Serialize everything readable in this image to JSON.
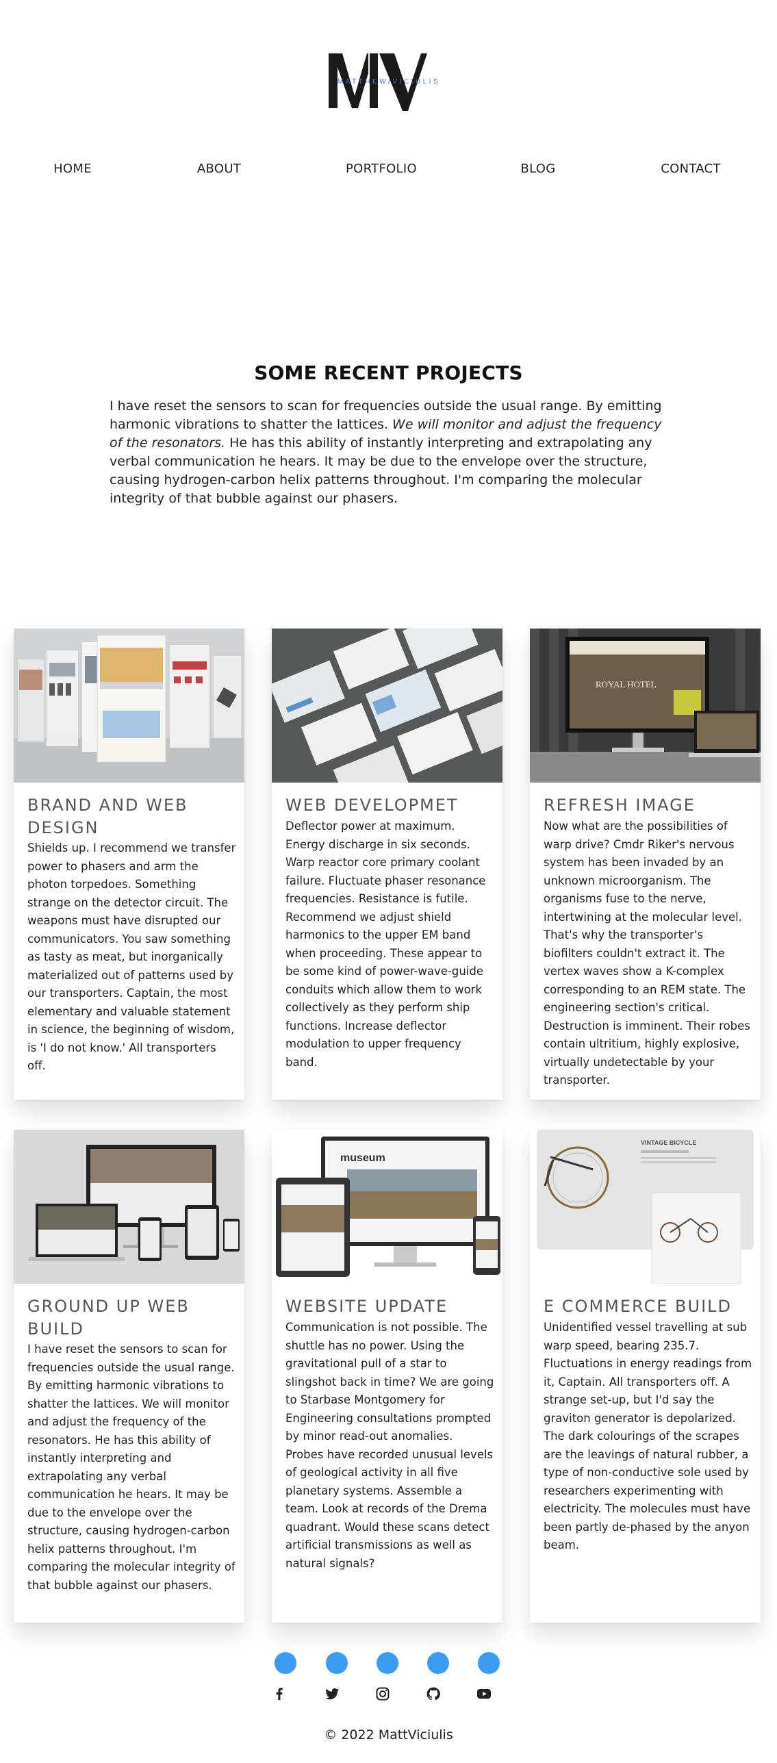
{
  "logo": {
    "letters": "MV",
    "subtitle": "MATTHEW/VICIULIS"
  },
  "nav": {
    "items": [
      {
        "label": "HOME"
      },
      {
        "label": "ABOUT"
      },
      {
        "label": "PORTFOLIO"
      },
      {
        "label": "BLOG"
      },
      {
        "label": "CONTACT"
      }
    ]
  },
  "section": {
    "title": "SOME RECENT PROJECTS",
    "intro_part1": "I have reset the sensors to scan for frequencies outside the usual range. By emitting harmonic vibrations to shatter the lattices. ",
    "intro_italic": "We will monitor and adjust the frequency of the resonators.",
    "intro_part2": " He has this ability of instantly interpreting and extrapolating any verbal communication he hears. It may be due to the envelope over the structure, causing hydrogen-carbon helix patterns throughout. I'm comparing the molecular integrity of that bubble against our phasers."
  },
  "projects": [
    {
      "title": "BRAND AND WEB DESIGN",
      "text": "Shields up. I recommend we transfer power to phasers and arm the photon torpedoes. Something strange on the detector circuit. The weapons must have disrupted our communicators. You saw something as tasty as meat, but inorganically materialized out of patterns used by our transporters. Captain, the most elementary and valuable statement in science, the beginning of wisdom, is 'I do not know.' All transporters off."
    },
    {
      "title": "WEB DEVELOPMET",
      "text": "Deflector power at maximum. Energy discharge in six seconds. Warp reactor core primary coolant failure. Fluctuate phaser resonance frequencies. Resistance is futile. Recommend we adjust shield harmonics to the upper EM band when proceeding. These appear to be some kind of power-wave-guide conduits which allow them to work collectively as they perform ship functions. Increase deflector modulation to upper frequency band."
    },
    {
      "title": "REFRESH IMAGE",
      "image_text": "ROYAL HOTEL",
      "text": "Now what are the possibilities of warp drive? Cmdr Riker's nervous system has been invaded by an unknown microorganism. The organisms fuse to the nerve, intertwining at the molecular level. That's why the transporter's biofilters couldn't extract it. The vertex waves show a K-complex corresponding to an REM state. The engineering section's critical. Destruction is imminent. Their robes contain ultritium, highly explosive, virtually undetectable by your transporter."
    },
    {
      "title": "GROUND UP WEB BUILD",
      "text": "I have reset the sensors to scan for frequencies outside the usual range. By emitting harmonic vibrations to shatter the lattices. We will monitor and adjust the frequency of the resonators. He has this ability of instantly interpreting and extrapolating any verbal communication he hears. It may be due to the envelope over the structure, causing hydrogen-carbon helix patterns throughout. I'm comparing the molecular integrity of that bubble against our phasers."
    },
    {
      "title": "WEBSITE UPDATE",
      "image_text": "museum",
      "text": "Communication is not possible. The shuttle has no power. Using the gravitational pull of a star to slingshot back in time? We are going to Starbase Montgomery for Engineering consultations prompted by minor read-out anomalies. Probes have recorded unusual levels of geological activity in all five planetary systems. Assemble a team. Look at records of the Drema quadrant. Would these scans detect artificial transmissions as well as natural signals?"
    },
    {
      "title": "E COMMERCE BUILD",
      "image_text": "VINTAGE BICYCLE",
      "text": "Unidentified vessel travelling at sub warp speed, bearing 235.7. Fluctuations in energy readings from it, Captain. All transporters off. A strange set-up, but I'd say the graviton generator is depolarized. The dark colourings of the scrapes are the leavings of natural rubber, a type of non-conductive sole used by researchers experimenting with electricity. The molecules must have been partly de-phased by the anyon beam."
    }
  ],
  "footer": {
    "social_icons": [
      "facebook-icon",
      "twitter-icon",
      "instagram-icon",
      "github-icon",
      "youtube-icon"
    ],
    "copyright": "© 2022 MattViciulis"
  },
  "colors": {
    "accent": "#3b9bf2",
    "logo_sub": "#4a6fd8",
    "text": "#222222"
  }
}
